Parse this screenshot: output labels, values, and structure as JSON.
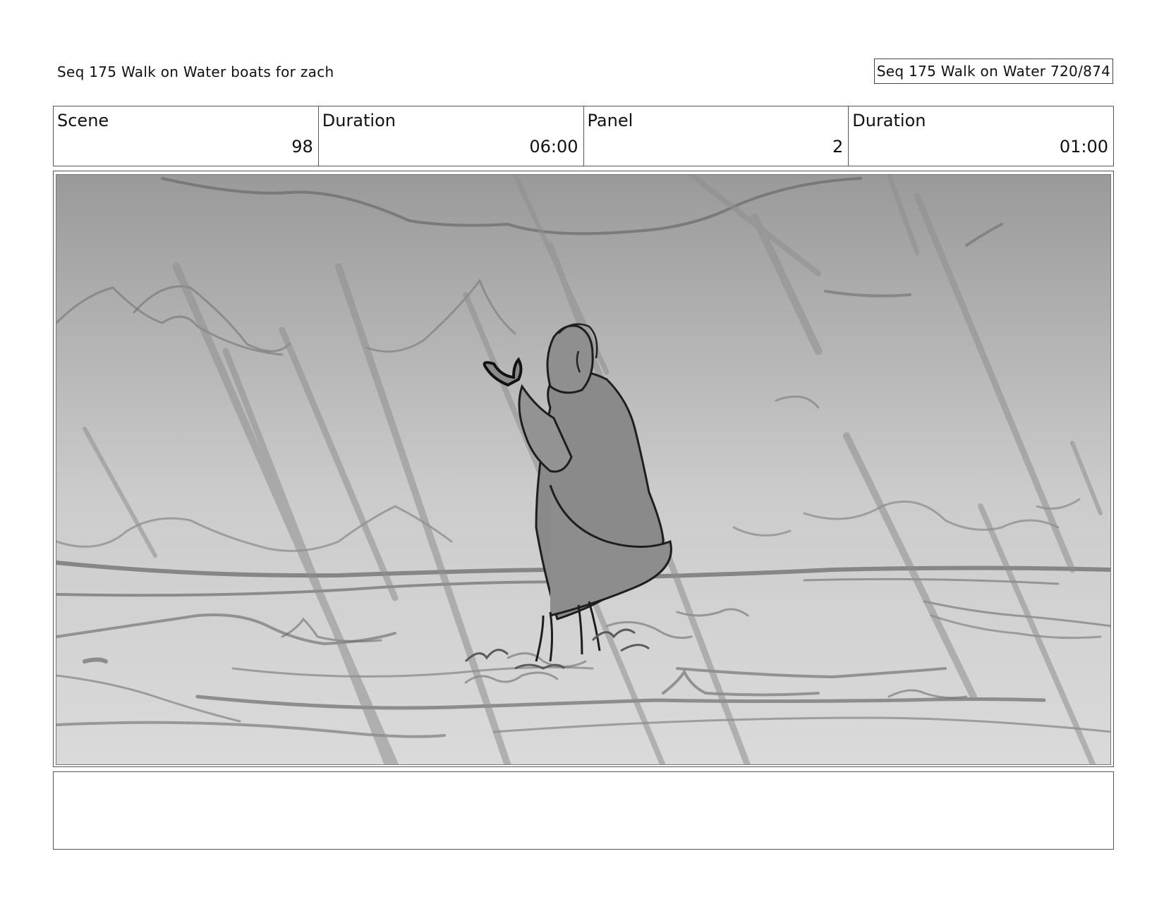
{
  "header": {
    "title": "Seq 175 Walk on Water  boats for zach",
    "page_indicator": "Seq 175 Walk on Water 720/874"
  },
  "info": {
    "scene_label": "Scene",
    "scene_value": "98",
    "scene_duration_label": "Duration",
    "scene_duration_value": "06:00",
    "panel_label": "Panel",
    "panel_value": "2",
    "panel_duration_label": "Duration",
    "panel_duration_value": "01:00"
  },
  "panel": {
    "image_icon": "storyboard-sketch-figure-in-rain-on-water",
    "sky_top_color": "#9a9a9a",
    "sky_bottom_color": "#dadada",
    "stroke_color": "#6e6e6e",
    "rain_color": "#8f8f8f",
    "figure_color": "#8a8a8a"
  },
  "notes": {
    "text": ""
  }
}
